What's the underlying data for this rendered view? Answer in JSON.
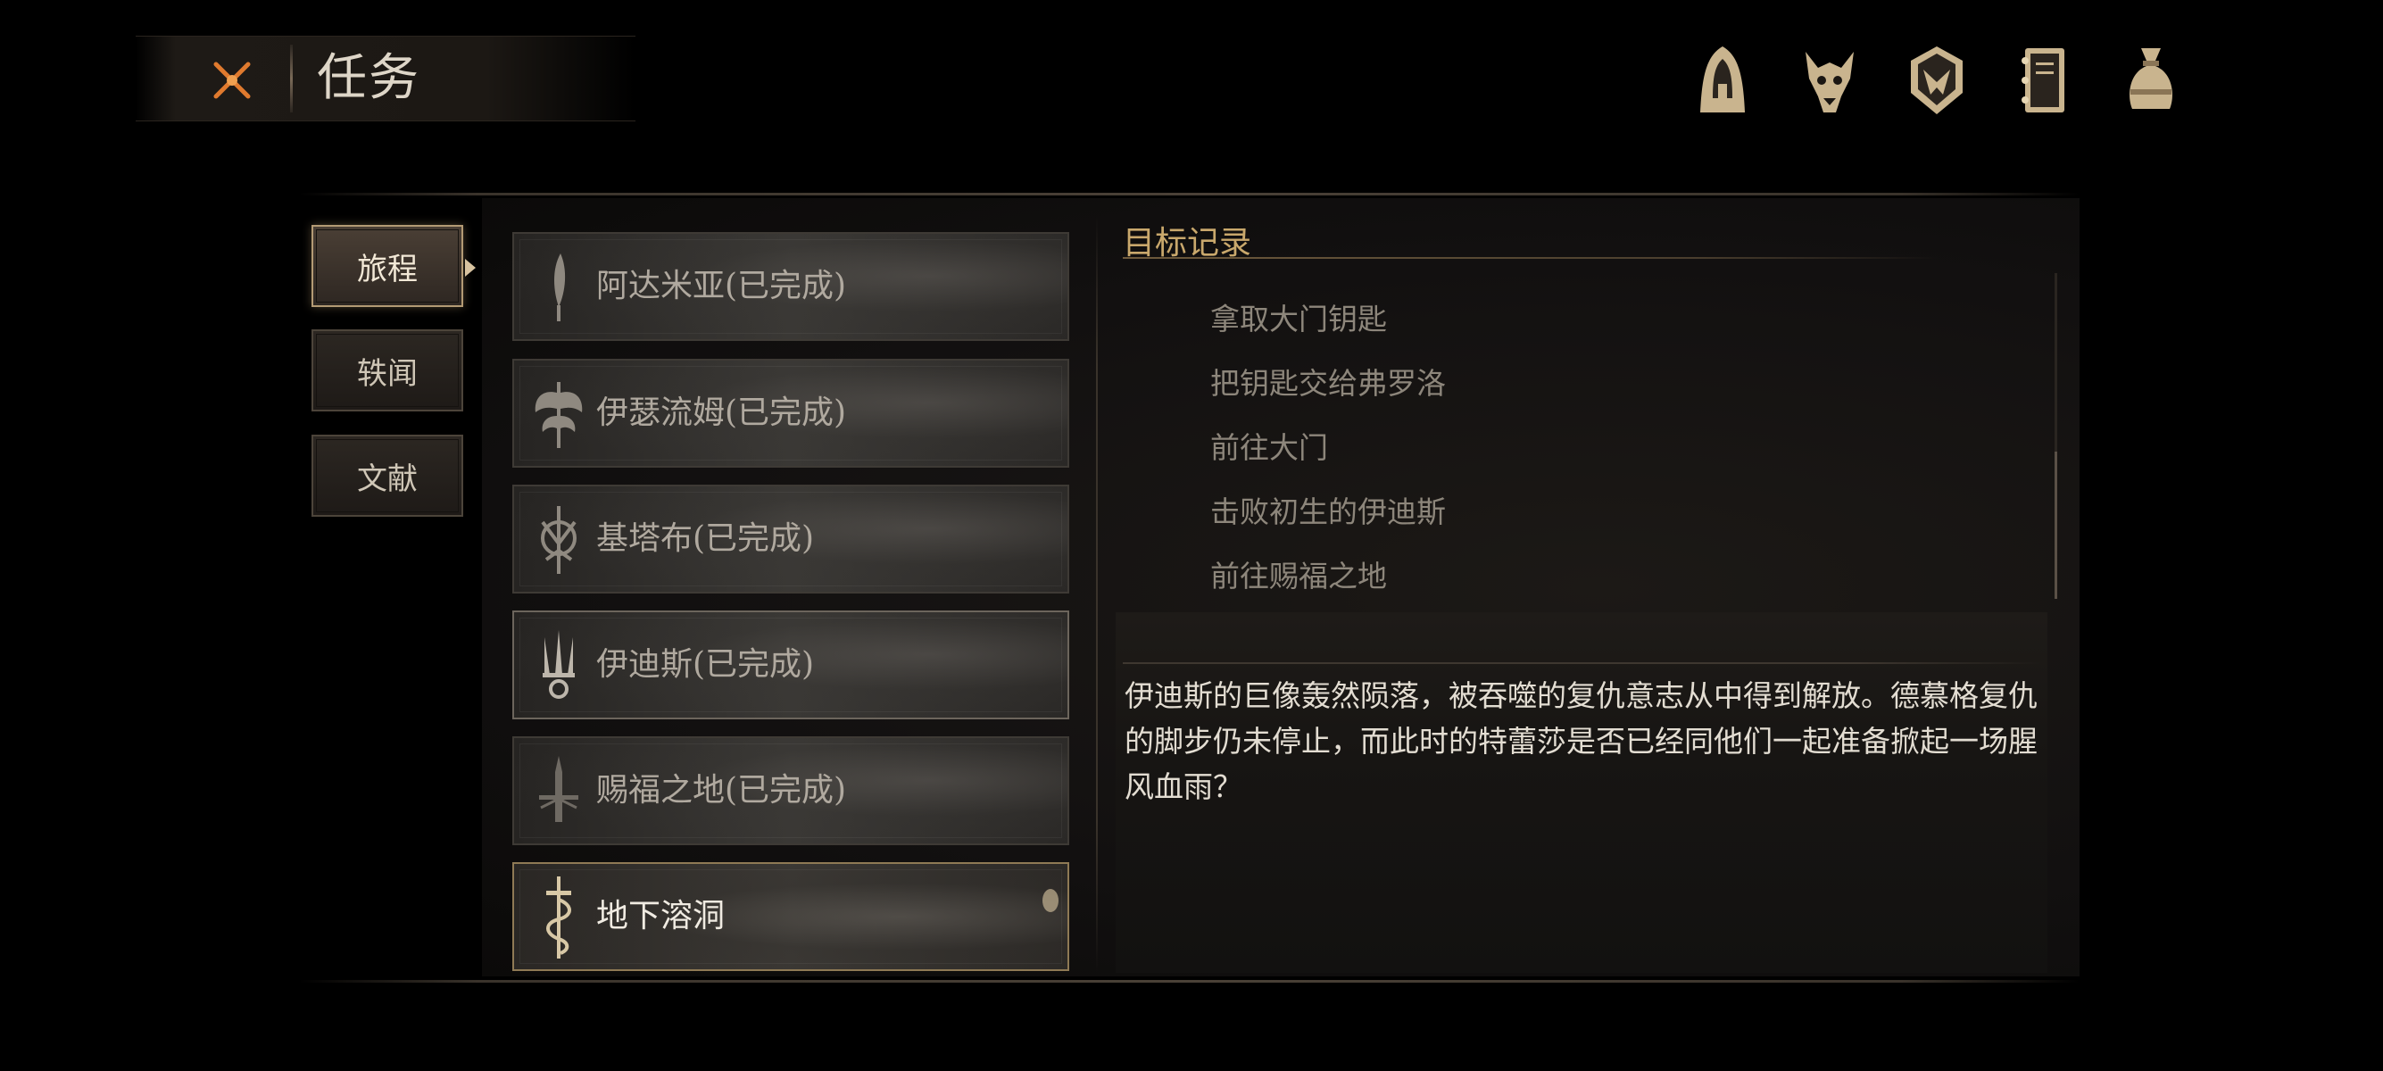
{
  "header": {
    "title": "任务",
    "close_icon": "close-x-icon"
  },
  "top_icons": [
    {
      "name": "hooded-figure-icon"
    },
    {
      "name": "beast-skull-icon"
    },
    {
      "name": "crest-shield-icon"
    },
    {
      "name": "journal-book-icon"
    },
    {
      "name": "coin-pouch-icon"
    }
  ],
  "tabs": [
    {
      "label": "旅程",
      "active": true
    },
    {
      "label": "轶闻",
      "active": false
    },
    {
      "label": "文献",
      "active": false
    }
  ],
  "quests": [
    {
      "label": "阿达米亚(已完成)",
      "icon": "feather-blade-icon"
    },
    {
      "label": "伊瑟流姆(已完成)",
      "icon": "twin-axe-icon"
    },
    {
      "label": "基塔布(已完成)",
      "icon": "crescent-emblem-icon"
    },
    {
      "label": "伊迪斯(已完成)",
      "icon": "trident-icon"
    },
    {
      "label": "赐福之地(已完成)",
      "icon": "cross-sword-icon"
    },
    {
      "label": "地下溶洞",
      "icon": "serpent-sword-icon"
    }
  ],
  "detail": {
    "section_title": "目标记录",
    "objectives": [
      "拿取大门钥匙",
      "把钥匙交给弗罗洛",
      "前往大门",
      "击败初生的伊迪斯",
      "前往赐福之地"
    ],
    "description": "伊迪斯的巨像轰然陨落，被吞噬的复仇意志从中得到解放。德慕格复仇的脚步仍未停止，而此时的特蕾莎是否已经同他们一起准备掀起一场腥风血雨？"
  },
  "colors": {
    "accent_gold": "#c9a86c",
    "close_orange": "#e07a2e",
    "icon_tan": "#c9b48e"
  }
}
